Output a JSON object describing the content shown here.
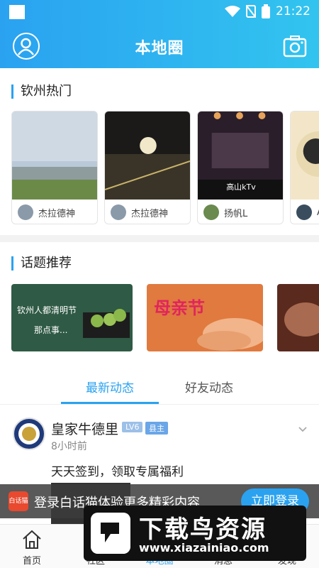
{
  "status": {
    "time": "21:22"
  },
  "header": {
    "title": "本地圈"
  },
  "hot": {
    "title": "钦州热门",
    "cards": [
      {
        "user": "杰拉德神",
        "kind": "lake"
      },
      {
        "user": "杰拉德神",
        "kind": "night-road"
      },
      {
        "user": "扬帆L",
        "kind": "ktv",
        "caption": "高山kTv"
      },
      {
        "user": "A",
        "kind": "food"
      }
    ]
  },
  "topics": {
    "title": "话题推荐",
    "items": [
      {
        "line1": "钦州人都清明节",
        "line2": "那点事..."
      },
      {
        "line1": "母亲节"
      },
      {
        "line1": ""
      }
    ]
  },
  "feed_tabs": {
    "latest": "最新动态",
    "friends": "好友动态"
  },
  "post": {
    "name": "皇家牛德里",
    "level": "LV6",
    "role": "县主",
    "time": "8小时前",
    "text": "天天签到，领取专属福利"
  },
  "login_banner": {
    "logo": "白话猫",
    "text": "登录白话猫体验更多精彩内容",
    "button": "立即登录"
  },
  "nav": {
    "home": "首页",
    "item2": "社区",
    "item3": "本地圈",
    "item4": "消息",
    "item5": "发现"
  },
  "watermark": {
    "text": "下载鸟资源",
    "url": "www.xiazainiao.com"
  },
  "colors": {
    "accent": "#2aa2f0",
    "accent2": "#32c4ef",
    "banner_btn": "#2aa2f0"
  }
}
